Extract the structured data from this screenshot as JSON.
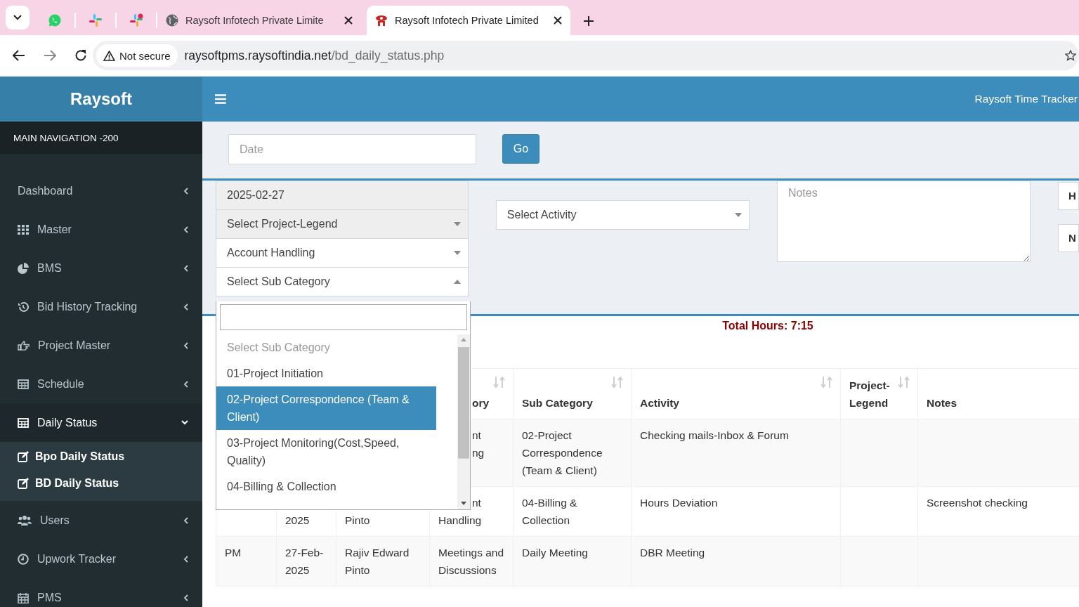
{
  "browser": {
    "tabs": [
      {
        "kind": "pinned",
        "selected": false
      },
      {
        "kind": "pinned",
        "selected": false
      },
      {
        "kind": "pinned",
        "selected": false
      },
      {
        "kind": "page",
        "title": "Raysoft Infotech Private Limite",
        "selected": false
      },
      {
        "kind": "page",
        "title": "Raysoft Infotech Private Limited",
        "selected": true
      }
    ],
    "address": {
      "security": "Not secure",
      "host": "raysoftpms.raysoftindia.net",
      "path": "/bd_daily_status.php"
    }
  },
  "header": {
    "logo": "Raysoft",
    "title": "Raysoft Time Tracker"
  },
  "sidebar": {
    "heading": "MAIN NAVIGATION -200",
    "items": [
      {
        "label": "Dashboard",
        "expanded": false,
        "selected": false
      },
      {
        "label": "Master",
        "expanded": false,
        "selected": false
      },
      {
        "label": "BMS",
        "expanded": false,
        "selected": false
      },
      {
        "label": "Bid History Tracking",
        "expanded": false,
        "selected": false
      },
      {
        "label": "Project Master",
        "expanded": false,
        "selected": false
      },
      {
        "label": "Schedule",
        "expanded": false,
        "selected": false
      },
      {
        "label": "Daily Status",
        "expanded": true,
        "selected": true,
        "children": [
          {
            "label": "Bpo Daily Status"
          },
          {
            "label": "BD Daily Status"
          }
        ]
      },
      {
        "label": "Users",
        "expanded": false,
        "selected": false
      },
      {
        "label": "Upwork Tracker",
        "expanded": false,
        "selected": false
      },
      {
        "label": "PMS",
        "expanded": false,
        "selected": false
      }
    ]
  },
  "filter": {
    "date": {
      "placeholder": "Date"
    },
    "go_button": "Go"
  },
  "form": {
    "fields": [
      {
        "kind": "text",
        "value": "2025-02-27",
        "disabled": true
      },
      {
        "kind": "select",
        "value": "Select Project-Legend",
        "disabled": true,
        "expanded": false
      },
      {
        "kind": "select",
        "value": "Account Handling",
        "disabled": false,
        "expanded": false
      },
      {
        "kind": "select",
        "value": "Select Sub Category",
        "disabled": false,
        "expanded": true
      }
    ],
    "activity": {
      "value": "Select Activity",
      "expanded": false
    },
    "notes": {
      "placeholder": "Notes"
    },
    "cut_fields": [
      "H",
      "N"
    ],
    "dropdown": {
      "options": [
        {
          "label": "Select Sub Category",
          "disabled": true,
          "selected": false
        },
        {
          "label": "01-Project Initiation",
          "disabled": false,
          "selected": false
        },
        {
          "label": "02-Project Correspondence (Team & Client)",
          "disabled": false,
          "selected": true
        },
        {
          "label": "03-Project Monitoring(Cost,Speed, Quality)",
          "disabled": false,
          "selected": false
        },
        {
          "label": "04-Billing & Collection",
          "disabled": false,
          "selected": false
        }
      ]
    }
  },
  "total_hours": "Total Hours: 7:15",
  "table": {
    "columns": [
      null,
      null,
      null,
      {
        "label": "ory",
        "sortable": true,
        "kind": "partial"
      },
      {
        "label": "Sub Category",
        "sortable": true,
        "kind": "plain"
      },
      {
        "label": "Activity",
        "sortable": true,
        "kind": "plain"
      },
      {
        "label": "Project-Legend",
        "sortable": true,
        "kind": "plain"
      },
      {
        "label": "Notes",
        "sortable": false,
        "kind": "plain"
      }
    ],
    "rows": [
      {
        "cells": [
          null,
          null,
          null,
          {
            "text": "nt\nng",
            "kind": "partial"
          },
          {
            "text": "02-Project Correspondence (Team & Client)",
            "kind": "plain"
          },
          {
            "text": "Checking mails-Inbox & Forum",
            "kind": "plain"
          },
          null,
          null
        ]
      },
      {
        "cells": [
          null,
          {
            "text": "\n2025",
            "kind": "plain"
          },
          {
            "text": "\nPinto",
            "kind": "plain"
          },
          {
            "text": "nt\nHandling",
            "kind": "partialfirst"
          },
          {
            "text": "04-Billing & Collection",
            "kind": "plain"
          },
          {
            "text": "Hours Deviation",
            "kind": "plain"
          },
          null,
          {
            "text": "Screenshot checking",
            "kind": "plain"
          }
        ]
      },
      {
        "cells": [
          {
            "text": "PM",
            "kind": "plain"
          },
          {
            "text": "27-Feb-2025",
            "kind": "plain"
          },
          {
            "text": "Rajiv Edward Pinto",
            "kind": "plain"
          },
          {
            "text": "Meetings and Discussions",
            "kind": "plain"
          },
          {
            "text": "Daily Meeting",
            "kind": "plain"
          },
          {
            "text": "DBR Meeting",
            "kind": "plain"
          },
          null,
          null
        ]
      }
    ]
  }
}
